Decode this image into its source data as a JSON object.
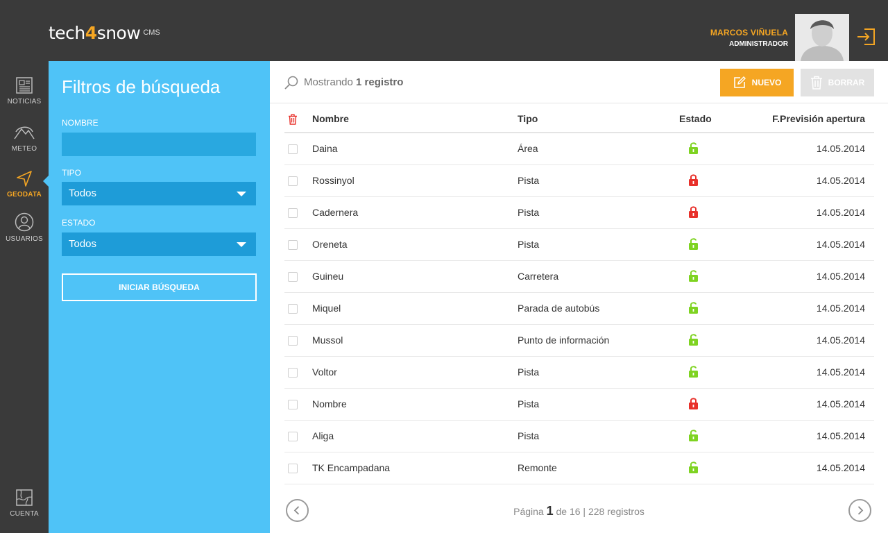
{
  "brand": {
    "logo_pre": "tech",
    "logo_four": "4",
    "logo_post": "snow",
    "logo_cms": "CMS",
    "accent": "#f5a623"
  },
  "user": {
    "name": "MARCOS VIÑUELA",
    "role": "ADMINISTRADOR"
  },
  "nav": {
    "items": [
      {
        "label": "NOTICIAS",
        "icon": "newspaper-icon"
      },
      {
        "label": "METEO",
        "icon": "mountain-icon"
      },
      {
        "label": "GEODATA",
        "icon": "navigation-icon",
        "active": true
      },
      {
        "label": "USUARIOS",
        "icon": "user-icon"
      }
    ],
    "account": {
      "label": "CUENTA",
      "icon": "map-icon"
    }
  },
  "filters": {
    "title": "Filtros de búsqueda",
    "nombre_label": "NOMBRE",
    "nombre_value": "",
    "tipo_label": "TIPO",
    "tipo_value": "Todos",
    "estado_label": "ESTADO",
    "estado_value": "Todos",
    "search_button": "INICIAR BÚSQUEDA"
  },
  "toolbar": {
    "showing_prefix": "Mostrando",
    "showing_count": "1 registro",
    "new_label": "NUEVO",
    "delete_label": "BORRAR"
  },
  "table": {
    "headers": {
      "name": "Nombre",
      "type": "Tipo",
      "state": "Estado",
      "date": "F.Previsión apertura"
    },
    "rows": [
      {
        "name": "Daina",
        "type": "Área",
        "state": "open",
        "date": "14.05.2014"
      },
      {
        "name": "Rossinyol",
        "type": "Pista",
        "state": "closed",
        "date": "14.05.2014"
      },
      {
        "name": "Cadernera",
        "type": "Pista",
        "state": "closed",
        "date": "14.05.2014"
      },
      {
        "name": "Oreneta",
        "type": "Pista",
        "state": "open",
        "date": "14.05.2014"
      },
      {
        "name": "Guineu",
        "type": "Carretera",
        "state": "open",
        "date": "14.05.2014"
      },
      {
        "name": "Miquel",
        "type": "Parada de autobús",
        "state": "open",
        "date": "14.05.2014"
      },
      {
        "name": "Mussol",
        "type": "Punto de información",
        "state": "open",
        "date": "14.05.2014"
      },
      {
        "name": "Voltor",
        "type": "Pista",
        "state": "open",
        "date": "14.05.2014"
      },
      {
        "name": "Nombre",
        "type": "Pista",
        "state": "closed",
        "date": "14.05.2014"
      },
      {
        "name": "Aliga",
        "type": "Pista",
        "state": "open",
        "date": "14.05.2014"
      },
      {
        "name": "TK Encampadana",
        "type": "Remonte",
        "state": "open",
        "date": "14.05.2014"
      }
    ]
  },
  "colors": {
    "open": "#7ed321",
    "closed": "#e8302a"
  },
  "pager": {
    "page_prefix": "Página",
    "current_page": "1",
    "of_text": "de 16 | 228 registros"
  }
}
